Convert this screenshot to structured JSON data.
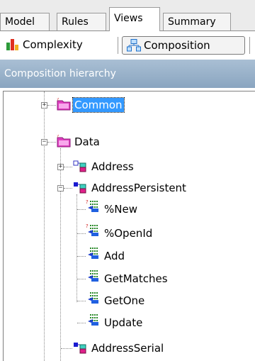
{
  "tabs": [
    {
      "label": "Model"
    },
    {
      "label": "Rules"
    },
    {
      "label": "Views"
    },
    {
      "label": "Summary"
    }
  ],
  "toolbar": {
    "complexity_label": "Complexity",
    "composition_label": "Composition"
  },
  "panel": {
    "title": "Composition hierarchy"
  },
  "tree": {
    "common": "Common",
    "data": "Data",
    "address": "Address",
    "address_persistent": "AddressPersistent",
    "methods": [
      "%New",
      "%OpenId",
      "Add",
      "GetMatches",
      "GetOne",
      "Update"
    ],
    "address_serial": "AddressSerial"
  },
  "colors": {
    "selection": "#3399ff",
    "panel_header": "#97b0c8",
    "folder": "#e040c0"
  }
}
